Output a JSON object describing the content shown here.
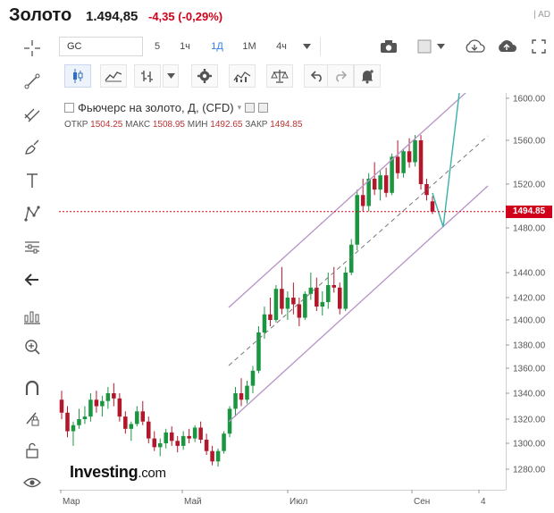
{
  "header": {
    "title": "Золото",
    "price": "1.494,85",
    "change": "-4,35 (-0,29%)",
    "ad_label": "| AD"
  },
  "toolbar": {
    "symbol": "GC",
    "intervals": [
      "5",
      "1ч",
      "1Д",
      "1М",
      "4ч"
    ],
    "active_interval": "1Д"
  },
  "left_tools": [
    "crosshair-icon",
    "trend-line-icon",
    "fib-icon",
    "brush-icon",
    "text-icon",
    "pattern-icon",
    "measure-icon",
    "back-arrow-icon",
    "indicators-icon",
    "zoom-icon",
    "magnet-icon",
    "lock-draw-icon",
    "unlock-icon",
    "eye-icon"
  ],
  "legend": {
    "title": "Фьючерс на золото, Д, (CFD)",
    "ohlc_open_label": "ОТКР",
    "ohlc_open": "1504.25",
    "ohlc_high_label": "МАКС",
    "ohlc_high": "1508.95",
    "ohlc_low_label": "МИН",
    "ohlc_low": "1492.65",
    "ohlc_close_label": "ЗАКР",
    "ohlc_close": "1494.85"
  },
  "watermark": {
    "brand": "Investing",
    "domain": ".com"
  },
  "price_tag": "1494.85",
  "colors": {
    "up": "#1a9641",
    "down": "#b2182b",
    "channel": "#b693c7",
    "projection": "#39b3a8",
    "last_price": "#d0021b"
  },
  "chart_data": {
    "type": "candlestick",
    "y_ticks": [
      "1600.00",
      "1560.00",
      "1520.00",
      "1480.00",
      "1440.00",
      "1420.00",
      "1400.00",
      "1380.00",
      "1360.00",
      "1340.00",
      "1320.00",
      "1300.00",
      "1280.00"
    ],
    "x_ticks": [
      "Мар",
      "Май",
      "Июл",
      "Сен",
      "4"
    ],
    "last_price": 1494.85,
    "candles": [
      [
        1335,
        1342,
        1320,
        1325
      ],
      [
        1325,
        1330,
        1305,
        1310
      ],
      [
        1310,
        1318,
        1298,
        1315
      ],
      [
        1315,
        1328,
        1312,
        1320
      ],
      [
        1320,
        1330,
        1316,
        1322
      ],
      [
        1322,
        1340,
        1318,
        1335
      ],
      [
        1335,
        1342,
        1325,
        1330
      ],
      [
        1330,
        1338,
        1322,
        1334
      ],
      [
        1334,
        1345,
        1328,
        1340
      ],
      [
        1340,
        1348,
        1330,
        1336
      ],
      [
        1336,
        1340,
        1318,
        1322
      ],
      [
        1322,
        1326,
        1308,
        1312
      ],
      [
        1312,
        1318,
        1302,
        1316
      ],
      [
        1316,
        1330,
        1314,
        1326
      ],
      [
        1326,
        1334,
        1315,
        1318
      ],
      [
        1318,
        1322,
        1300,
        1304
      ],
      [
        1304,
        1310,
        1294,
        1297
      ],
      [
        1297,
        1304,
        1290,
        1300
      ],
      [
        1300,
        1312,
        1296,
        1309
      ],
      [
        1309,
        1314,
        1298,
        1302
      ],
      [
        1302,
        1306,
        1293,
        1298
      ],
      [
        1298,
        1310,
        1295,
        1306
      ],
      [
        1306,
        1312,
        1300,
        1304
      ],
      [
        1304,
        1315,
        1301,
        1313
      ],
      [
        1313,
        1318,
        1300,
        1303
      ],
      [
        1303,
        1308,
        1291,
        1294
      ],
      [
        1294,
        1298,
        1283,
        1286
      ],
      [
        1286,
        1296,
        1282,
        1294
      ],
      [
        1294,
        1310,
        1292,
        1308
      ],
      [
        1308,
        1330,
        1305,
        1328
      ],
      [
        1328,
        1345,
        1322,
        1340
      ],
      [
        1340,
        1352,
        1330,
        1335
      ],
      [
        1335,
        1350,
        1332,
        1346
      ],
      [
        1346,
        1362,
        1340,
        1358
      ],
      [
        1358,
        1395,
        1356,
        1390
      ],
      [
        1390,
        1412,
        1385,
        1405
      ],
      [
        1405,
        1420,
        1395,
        1400
      ],
      [
        1400,
        1430,
        1398,
        1427
      ],
      [
        1427,
        1445,
        1405,
        1410
      ],
      [
        1410,
        1425,
        1400,
        1420
      ],
      [
        1420,
        1432,
        1405,
        1414
      ],
      [
        1414,
        1420,
        1395,
        1402
      ],
      [
        1402,
        1425,
        1400,
        1423
      ],
      [
        1423,
        1440,
        1418,
        1428
      ],
      [
        1428,
        1436,
        1408,
        1412
      ],
      [
        1412,
        1425,
        1404,
        1416
      ],
      [
        1416,
        1440,
        1410,
        1430
      ],
      [
        1430,
        1445,
        1424,
        1428
      ],
      [
        1428,
        1432,
        1405,
        1410
      ],
      [
        1410,
        1445,
        1408,
        1440
      ],
      [
        1440,
        1470,
        1438,
        1465
      ],
      [
        1465,
        1515,
        1460,
        1510
      ],
      [
        1510,
        1525,
        1495,
        1500
      ],
      [
        1500,
        1530,
        1495,
        1525
      ],
      [
        1525,
        1540,
        1510,
        1515
      ],
      [
        1515,
        1532,
        1505,
        1528
      ],
      [
        1528,
        1535,
        1508,
        1512
      ],
      [
        1512,
        1548,
        1510,
        1545
      ],
      [
        1545,
        1560,
        1525,
        1530
      ],
      [
        1530,
        1552,
        1526,
        1550
      ],
      [
        1550,
        1562,
        1535,
        1540
      ],
      [
        1540,
        1565,
        1536,
        1560
      ],
      [
        1560,
        1565,
        1515,
        1520
      ],
      [
        1520,
        1525,
        1505,
        1510
      ],
      [
        1504.25,
        1508.95,
        1492.65,
        1494.85
      ]
    ]
  }
}
